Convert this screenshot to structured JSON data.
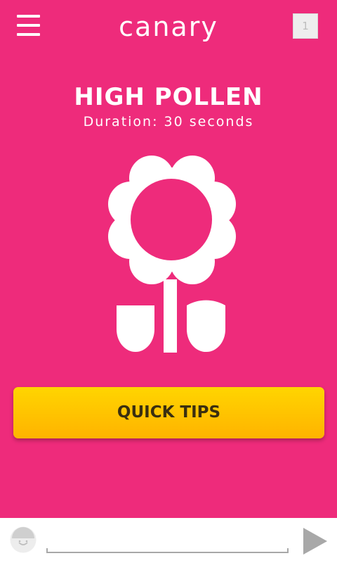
{
  "header": {
    "app_title": "canary",
    "menu_icon": "hamburger-menu-icon",
    "notification_count": "1"
  },
  "alert": {
    "title": "HIGH POLLEN",
    "duration": "Duration: 30 seconds",
    "icon": "flower-icon"
  },
  "actions": {
    "quick_tips_label": "QUICK TIPS"
  },
  "bottom_bar": {
    "avatar_icon": "smiley-avatar-icon",
    "message_value": "",
    "send_icon": "play-send-icon"
  },
  "colors": {
    "background": "#ee2b7b",
    "button_top": "#ffd500",
    "button_bottom": "#ffb300",
    "text": "#ffffff"
  }
}
